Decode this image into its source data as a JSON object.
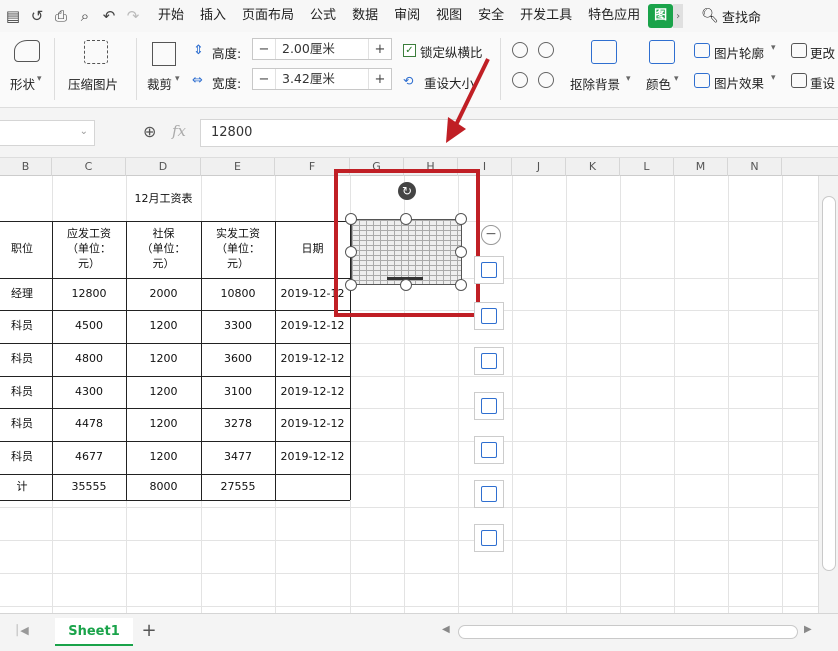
{
  "menubar": {
    "quick_access": [
      "save-icon",
      "undo-history-icon",
      "print-icon",
      "print-preview-icon",
      "undo-icon",
      "redo-icon"
    ],
    "items": [
      "开始",
      "插入",
      "页面布局",
      "公式",
      "数据",
      "审阅",
      "视图",
      "安全",
      "开发工具",
      "特色应用"
    ],
    "active_tab": "图",
    "search_label": "查找命"
  },
  "ribbon": {
    "shape_label": "形状",
    "compress_label": "压缩图片",
    "crop_label": "裁剪",
    "height_label": "高度:",
    "height_value": "2.00厘米",
    "width_label": "宽度:",
    "width_value": "3.42厘米",
    "lock_ratio_label": "锁定纵横比",
    "reset_size_label": "重设大小",
    "remove_bg_label": "抠除背景",
    "color_label": "颜色",
    "outline_label": "图片轮廓",
    "effect_label": "图片效果",
    "change_label": "更改",
    "reset_label": "重设"
  },
  "formula": {
    "fx_label": "fx",
    "value": "12800"
  },
  "columns": [
    "B",
    "C",
    "D",
    "E",
    "F",
    "G",
    "H",
    "I",
    "J",
    "K",
    "L",
    "M",
    "N"
  ],
  "sheet_table": {
    "title": "12月工资表",
    "headers": [
      "职位",
      "应发工资\n（单位：\n元）",
      "社保\n（单位：\n元）",
      "实发工资\n（单位：\n元）",
      "日期"
    ],
    "rows": [
      [
        "经理",
        "12800",
        "2000",
        "10800",
        "2019-12-12"
      ],
      [
        "科员",
        "4500",
        "1200",
        "3300",
        "2019-12-12"
      ],
      [
        "科员",
        "4800",
        "1200",
        "3600",
        "2019-12-12"
      ],
      [
        "科员",
        "4300",
        "1200",
        "3100",
        "2019-12-12"
      ],
      [
        "科员",
        "4478",
        "1200",
        "3278",
        "2019-12-12"
      ],
      [
        "科员",
        "4677",
        "1200",
        "3477",
        "2019-12-12"
      ]
    ],
    "total": [
      "计",
      "35555",
      "8000",
      "27555",
      ""
    ]
  },
  "float_toolbar": [
    "zoom-in-icon",
    "edit-image-icon",
    "crop-icon",
    "compress-icon",
    "image-convert-icon",
    "image-pdf-icon",
    "image-settings-icon"
  ],
  "sheets": {
    "active": "Sheet1",
    "add_label": "+"
  },
  "colors": {
    "accent_green": "#1aa34a",
    "highlight_red": "#c01f25"
  }
}
